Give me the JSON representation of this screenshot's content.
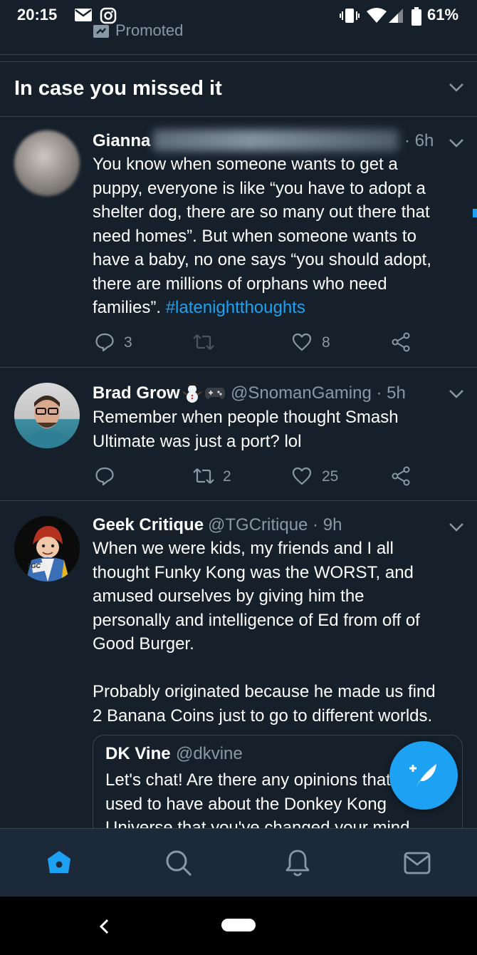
{
  "status_bar": {
    "time": "20:15",
    "battery": "61%",
    "icons": [
      "mail-icon",
      "instagram-icon",
      "vibrate-icon",
      "wifi-icon",
      "signal-icon",
      "battery-icon"
    ]
  },
  "promoted": {
    "label": "Promoted"
  },
  "section": {
    "title": "In case you missed it"
  },
  "tweets": [
    {
      "name": "Gianna",
      "time": "· 6h",
      "lines": [
        "You know when someone wants to get a",
        "puppy, everyone is like “you have to adopt a",
        "shelter dog, there are so many out there that",
        "need homes”. But when someone wants to",
        "have a baby, no one says “you should adopt,",
        "there are millions of orphans who need"
      ],
      "last_line_text": "families”.",
      "hashtag": "#latenightthoughts",
      "replies": "3",
      "retweets": "",
      "likes": "8"
    },
    {
      "name": "Brad Grow",
      "handle_time": "@SnomanGaming · 5h",
      "lines": [
        "Remember when people thought Smash",
        "Ultimate was just a port? lol"
      ],
      "replies": "",
      "retweets": "2",
      "likes": "25"
    },
    {
      "name": "Geek Critique",
      "handle_time": "@TGCritique · 9h",
      "avatar_text": "TGC",
      "lines": [
        "When we were kids, my friends and I all",
        "thought Funky Kong was the WORST, and",
        "amused ourselves by giving him the",
        "personally and intelligence of Ed from off of",
        "Good Burger.",
        "",
        "Probably originated because he made us find",
        "2 Banana Coins just to go to different worlds."
      ],
      "quoted": {
        "name": "DK Vine",
        "handle": "@dkvine",
        "lines": [
          "Let's chat! Are there any opinions that you",
          "used to have about the Donkey Kong",
          "Universe that you've changed your mind"
        ]
      }
    }
  ],
  "colors": {
    "background": "#15202b",
    "accent": "#1da1f2",
    "secondary_text": "#8899a6",
    "divider": "#38444d",
    "nav_bar": "#1c2938"
  },
  "bottom_nav": [
    "home-icon",
    "search-icon",
    "notifications-icon",
    "messages-icon"
  ]
}
